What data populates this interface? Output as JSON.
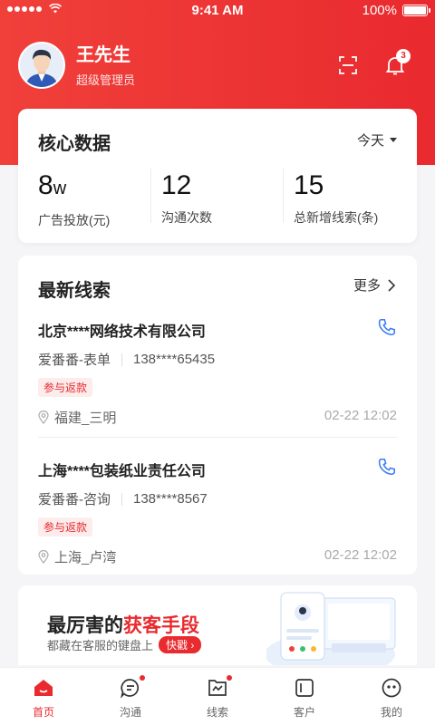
{
  "status_bar": {
    "time": "9:41 AM",
    "battery": "100%"
  },
  "header": {
    "user_name": "王先生",
    "user_role": "超级管理员",
    "notification_count": "3"
  },
  "core": {
    "title": "核心数据",
    "period": "今天",
    "stats": [
      {
        "value": "8",
        "unit": "w",
        "label": "广告投放(元)"
      },
      {
        "value": "12",
        "unit": "",
        "label": "沟通次数"
      },
      {
        "value": "15",
        "unit": "",
        "label": "总新增线索(条)"
      }
    ]
  },
  "leads": {
    "title": "最新线索",
    "more": "更多",
    "items": [
      {
        "company": "北京****网络技术有限公司",
        "source": "爱番番-表单",
        "phone": "138****65435",
        "tag": "参与返款",
        "location": "福建_三明",
        "date": "02-22 12:02"
      },
      {
        "company": "上海****包装纸业责任公司",
        "source": "爱番番-咨询",
        "phone": "138****8567",
        "tag": "参与返款",
        "location": "上海_卢湾",
        "date": "02-22 12:02"
      }
    ]
  },
  "banner": {
    "title_part1": "最厉害的",
    "title_part2": "获客手段",
    "subtitle": "都藏在客服的键盘上",
    "cta": "快戳"
  },
  "tabbar": {
    "items": [
      {
        "label": "首页",
        "active": true
      },
      {
        "label": "沟通",
        "dot": true
      },
      {
        "label": "线索",
        "dot": true
      },
      {
        "label": "客户"
      },
      {
        "label": "我的"
      }
    ]
  },
  "colors": {
    "brand": "#e92a2f",
    "link_blue": "#3b7cf6"
  }
}
